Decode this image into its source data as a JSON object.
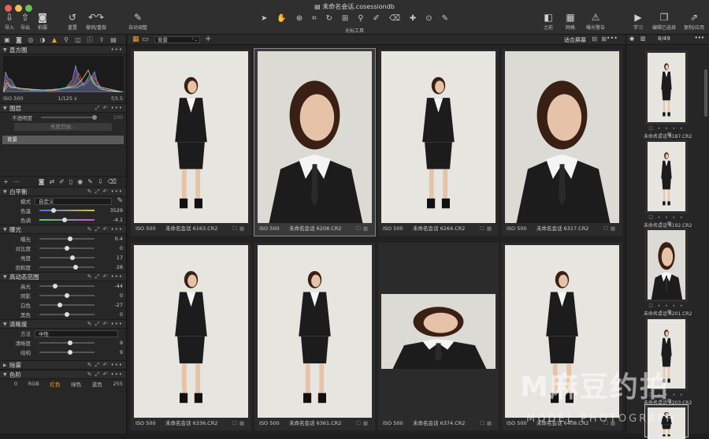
{
  "window": {
    "title": "未命名会话.cosessiondb"
  },
  "toolbar": {
    "import": "导入",
    "export": "导出",
    "capture": "拍摄",
    "redo": "重置",
    "undo_redo": "撤销/重做",
    "auto_adjust": "自动调整",
    "cursor_tools": "光标工具",
    "before": "之前",
    "grid": "网格",
    "exposure_warning": "曝光警告",
    "learn": "学习",
    "edit_selected": "编辑已选择",
    "copy_apply": "复制/应用"
  },
  "histogram": {
    "title": "直方图",
    "iso": "ISO 500",
    "shutter": "1/125 s",
    "aperture": "f/3.5"
  },
  "layers": {
    "title": "图层",
    "opacity_label": "不透明度",
    "opacity_value": "100",
    "brightness_range": "亮度范围...",
    "background_layer": "背景"
  },
  "white_balance": {
    "title": "白平衡",
    "mode_label": "模式",
    "mode_value": "自定义",
    "temp_label": "色温",
    "temp_value": "3529",
    "tint_label": "色调",
    "tint_value": "-4.1"
  },
  "exposure": {
    "title": "曝光",
    "rows": [
      {
        "label": "曝光",
        "value": "0.4",
        "pos": 0.55
      },
      {
        "label": "对比度",
        "value": "0",
        "pos": 0.5
      },
      {
        "label": "亮度",
        "value": "17",
        "pos": 0.6
      },
      {
        "label": "饱和度",
        "value": "28",
        "pos": 0.65
      }
    ]
  },
  "hdr": {
    "title": "高动态范围",
    "rows": [
      {
        "label": "高光",
        "value": "-44",
        "pos": 0.28
      },
      {
        "label": "阴影",
        "value": "0",
        "pos": 0.5
      },
      {
        "label": "白色",
        "value": "-27",
        "pos": 0.37
      },
      {
        "label": "黑色",
        "value": "0",
        "pos": 0.5
      }
    ]
  },
  "clarity": {
    "title": "清晰度",
    "method_label": "方法",
    "method_value": "中性",
    "rows": [
      {
        "label": "清晰度",
        "value": "9",
        "pos": 0.55
      },
      {
        "label": "结构",
        "value": "9",
        "pos": 0.55
      }
    ]
  },
  "dehaze": {
    "title": "除雾"
  },
  "levels": {
    "title": "色阶",
    "low": "0",
    "rgb": "RGB",
    "red": "红色",
    "green": "绿色",
    "blue": "蓝色",
    "high": "255"
  },
  "browser": {
    "filter_value": "背景",
    "fit_label": "适合屏幕"
  },
  "grid_images": [
    {
      "iso": "ISO 500",
      "name": "未命名会话 6163.CR2"
    },
    {
      "iso": "ISO 500",
      "name": "未命名会话 6208.CR2"
    },
    {
      "iso": "ISO 500",
      "name": "未命名会话 6264.CR2"
    },
    {
      "iso": "ISO 500",
      "name": "未命名会话 6317.CR2"
    },
    {
      "iso": "ISO 500",
      "name": "未命名会话 6336.CR2"
    },
    {
      "iso": "ISO 500",
      "name": "未命名会话 6361.CR2"
    },
    {
      "iso": "ISO 500",
      "name": "未命名会话 6374.CR2"
    },
    {
      "iso": "ISO 500",
      "name": "未命名会话 6408.CR2"
    }
  ],
  "filmstrip": {
    "counter": "8/49",
    "items": [
      {
        "name": "未命名会话 6187.CR2"
      },
      {
        "name": "未命名会话 6192.CR2"
      },
      {
        "name": "未命名会话 6201.CR2"
      },
      {
        "name": "未命名会话 6203.CR2"
      }
    ]
  },
  "watermark": {
    "brand": "M麻豆约拍",
    "sub": "MODEL PHOTOGRAPH"
  },
  "colors": {
    "accent": "#f0a020",
    "panel": "#272727",
    "photo_bg": "#e7e5e0",
    "suit": "#1c1c1c"
  }
}
